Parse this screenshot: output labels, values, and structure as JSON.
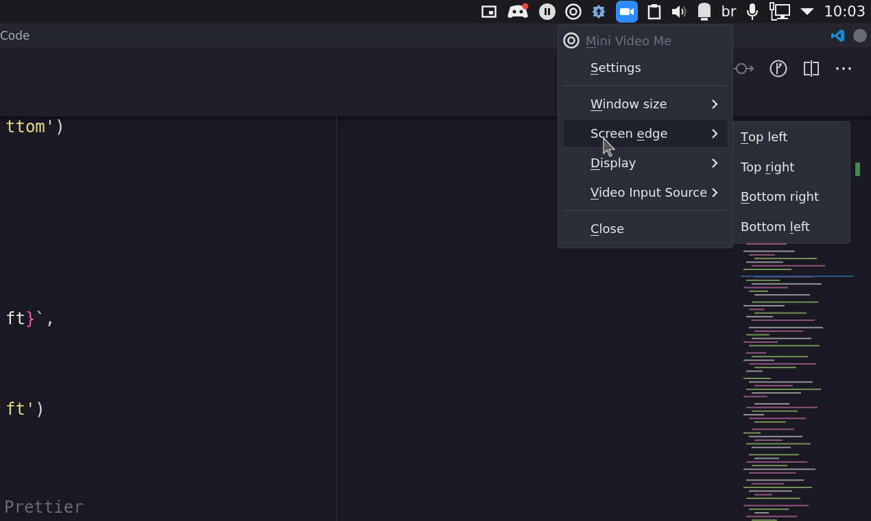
{
  "tray": {
    "keyboard_layout": "br",
    "clock": "10:03"
  },
  "window": {
    "title": "Code"
  },
  "editor": {
    "lines": [
      {
        "tokens": [
          {
            "text": "ttom'",
            "kind": "string"
          },
          {
            "text": ")",
            "kind": "punct"
          }
        ]
      },
      {
        "tokens": [
          {
            "text": "ft",
            "kind": "plain"
          },
          {
            "text": "}",
            "kind": "brace"
          },
          {
            "text": "`,",
            "kind": "punct"
          }
        ]
      },
      {
        "tokens": [
          {
            "text": "ft'",
            "kind": "string"
          },
          {
            "text": ")",
            "kind": "punct"
          }
        ]
      }
    ]
  },
  "status_bar": {
    "formatter": "Prettier"
  },
  "menu": {
    "title": [
      {
        "text": "M",
        "underlined": true
      },
      {
        "text": "ini Video Me",
        "underlined": false
      }
    ],
    "items": [
      {
        "kind": "item",
        "label": [
          {
            "text": "S",
            "underlined": true
          },
          {
            "text": "ettings",
            "underlined": false
          }
        ],
        "highlighted": false
      },
      {
        "kind": "separator"
      },
      {
        "kind": "submenu",
        "label": [
          {
            "text": "W",
            "underlined": true
          },
          {
            "text": "indow size",
            "underlined": false
          }
        ],
        "highlighted": false
      },
      {
        "kind": "submenu",
        "label": [
          {
            "text": "Screen ",
            "underlined": false
          },
          {
            "text": "e",
            "underlined": true
          },
          {
            "text": "dge",
            "underlined": false
          }
        ],
        "highlighted": true
      },
      {
        "kind": "submenu",
        "label": [
          {
            "text": "D",
            "underlined": true
          },
          {
            "text": "isplay",
            "underlined": false
          }
        ],
        "highlighted": false
      },
      {
        "kind": "submenu",
        "label": [
          {
            "text": "V",
            "underlined": true
          },
          {
            "text": "ideo Input Source",
            "underlined": false
          }
        ],
        "highlighted": false
      },
      {
        "kind": "separator"
      },
      {
        "kind": "item",
        "label": [
          {
            "text": "C",
            "underlined": true
          },
          {
            "text": "lose",
            "underlined": false
          }
        ],
        "highlighted": false
      }
    ]
  },
  "submenu": {
    "items": [
      {
        "label": [
          {
            "text": "T",
            "underlined": true
          },
          {
            "text": "op left",
            "underlined": false
          }
        ]
      },
      {
        "label": [
          {
            "text": "Top ",
            "underlined": false
          },
          {
            "text": "r",
            "underlined": true
          },
          {
            "text": "ight",
            "underlined": false
          }
        ]
      },
      {
        "label": [
          {
            "text": "B",
            "underlined": true
          },
          {
            "text": "ottom right",
            "underlined": false
          }
        ]
      },
      {
        "label": [
          {
            "text": "Bottom ",
            "underlined": false
          },
          {
            "text": "l",
            "underlined": true
          },
          {
            "text": "eft",
            "underlined": false
          }
        ]
      }
    ]
  }
}
